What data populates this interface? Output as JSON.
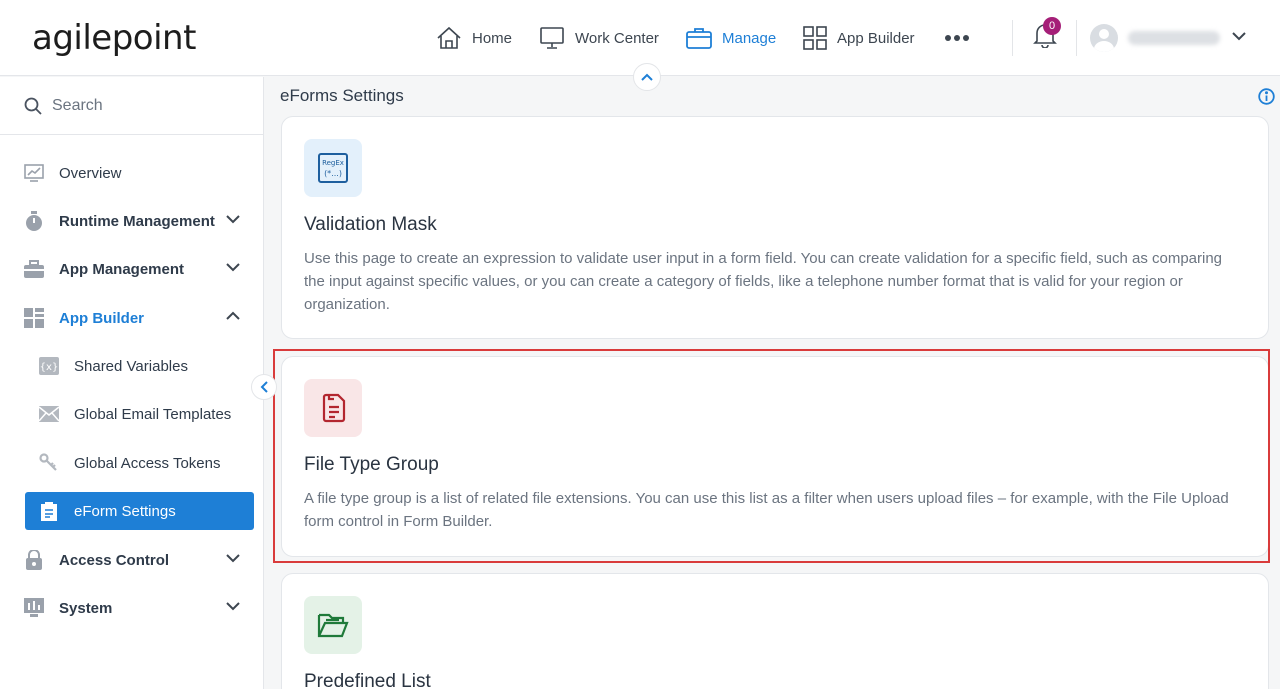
{
  "app": {
    "logo_text": "agilepoint"
  },
  "topnav": {
    "items": [
      {
        "label": "Home",
        "icon": "home-icon"
      },
      {
        "label": "Work Center",
        "icon": "monitor-icon"
      },
      {
        "label": "Manage",
        "icon": "briefcase-icon",
        "active": true
      },
      {
        "label": "App Builder",
        "icon": "grid-icon"
      }
    ],
    "more_icon": "more-icon",
    "notification_count": "0"
  },
  "sidebar": {
    "search_placeholder": "Search",
    "items": [
      {
        "label": "Overview",
        "icon": "chart-icon"
      },
      {
        "label": "Runtime Management",
        "icon": "stopwatch-icon",
        "expandable": true
      },
      {
        "label": "App Management",
        "icon": "toolbox-icon",
        "expandable": true
      },
      {
        "label": "App Builder",
        "icon": "blocks-icon",
        "expandable": true,
        "open": true
      },
      {
        "label": "Shared Variables",
        "icon": "variable-icon"
      },
      {
        "label": "Global Email Templates",
        "icon": "envelope-icon"
      },
      {
        "label": "Global Access Tokens",
        "icon": "keys-icon"
      },
      {
        "label": "eForm Settings",
        "icon": "clipboard-icon",
        "selected": true
      },
      {
        "label": "Access Control",
        "icon": "lock-icon",
        "expandable": true
      },
      {
        "label": "System",
        "icon": "system-icon",
        "expandable": true
      }
    ]
  },
  "main": {
    "title": "eForms Settings",
    "cards": [
      {
        "title": "Validation Mask",
        "description": "Use this page to create an expression to validate user input in a form field. You can create validation for a specific field, such as comparing the input against specific values, or you can create a category of fields, like a telephone number format that is valid for your region or organization.",
        "icon": "regex-icon",
        "icon_text_top": "RegEx",
        "icon_text_bottom": "(*...)",
        "tile_color": "#e3f0fb"
      },
      {
        "title": "File Type Group",
        "description": "A file type group is a list of related file extensions. You can use this list as a filter when users upload files – for example, with the File Upload form control in Form Builder.",
        "icon": "file-list-icon",
        "tile_color": "#f9e6e7"
      },
      {
        "title": "Predefined List",
        "description": "",
        "icon": "folder-open-icon",
        "tile_color": "#e4f2e7"
      }
    ]
  },
  "colors": {
    "accent": "#1e7fd6",
    "highlight": "#d93b3b",
    "badge": "#a51f78"
  }
}
